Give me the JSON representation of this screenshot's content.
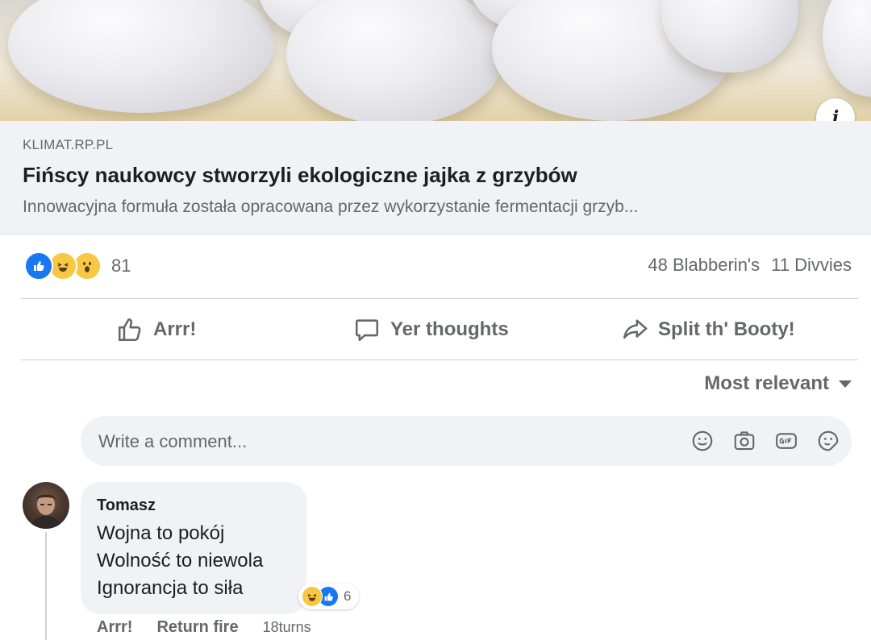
{
  "link_preview": {
    "domain": "KLIMAT.RP.PL",
    "headline": "Fińscy naukowcy stworzyli ekologiczne jajka z grzybów",
    "description": "Innowacyjna formuła została opracowana przez wykorzystanie fermentacji grzyb..."
  },
  "reactions": {
    "count": "81",
    "icons": [
      "like",
      "haha",
      "wow"
    ]
  },
  "stats": {
    "comments": "48 Blabberin's",
    "shares": "11 Divvies"
  },
  "actions": {
    "like": "Arrr!",
    "comment": "Yer thoughts",
    "share": "Split th' Booty!"
  },
  "sort": {
    "label": "Most relevant"
  },
  "comment_box": {
    "placeholder": "Write a comment...",
    "icons": [
      "emoji-icon",
      "camera-icon",
      "gif-icon",
      "sticker-icon"
    ]
  },
  "comment": {
    "author": "Tomasz",
    "lines": [
      "Wojna to pokój",
      "Wolność to niewola",
      "Ignorancja to siła"
    ],
    "reaction_count": "6",
    "like_label": "Arrr!",
    "reply_label": "Return fire",
    "time": "18turns"
  },
  "colors": {
    "accent": "#1877f2",
    "muted": "#65676b",
    "surface": "#f0f2f5",
    "reaction_yellow": "#f7c843"
  }
}
